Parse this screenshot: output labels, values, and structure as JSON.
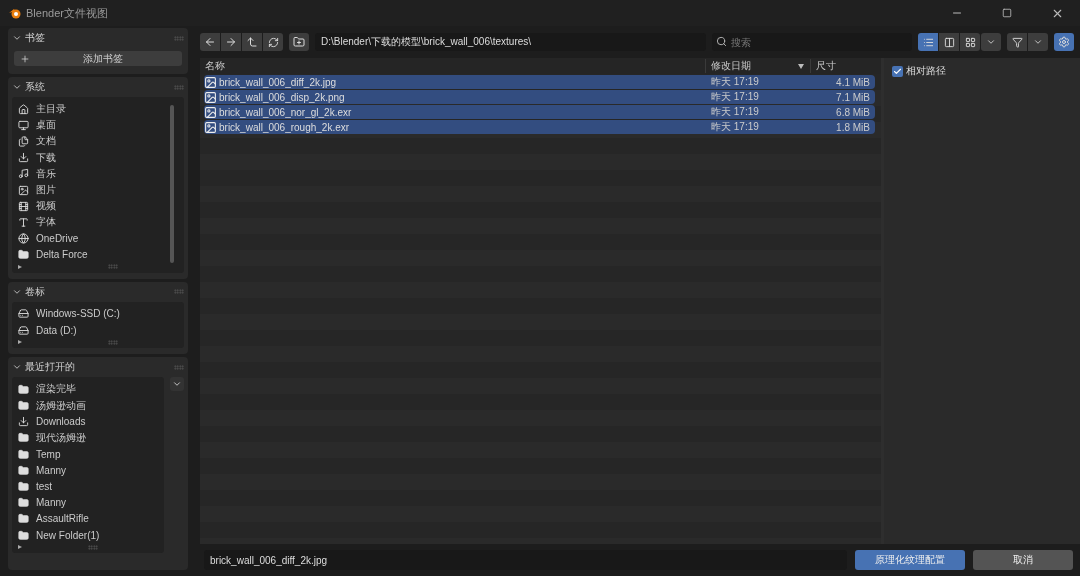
{
  "window": {
    "title": "Blender文件视图"
  },
  "sidebar": {
    "sections": [
      {
        "title": "书签",
        "expanded": true,
        "add_button": "添加书签"
      },
      {
        "title": "系统",
        "expanded": true,
        "items": [
          {
            "label": "主目录",
            "kind": "home"
          },
          {
            "label": "桌面",
            "kind": "desktop"
          },
          {
            "label": "文档",
            "kind": "documents"
          },
          {
            "label": "下载",
            "kind": "download"
          },
          {
            "label": "音乐",
            "kind": "music"
          },
          {
            "label": "图片",
            "kind": "image"
          },
          {
            "label": "视频",
            "kind": "video"
          },
          {
            "label": "字体",
            "kind": "font"
          },
          {
            "label": "OneDrive",
            "kind": "globe"
          },
          {
            "label": "Delta Force",
            "kind": "folder"
          }
        ]
      },
      {
        "title": "卷标",
        "expanded": true,
        "items": [
          {
            "label": "Windows-SSD (C:)",
            "kind": "drive"
          },
          {
            "label": "Data (D:)",
            "kind": "drive"
          }
        ]
      },
      {
        "title": "最近打开的",
        "expanded": true,
        "items": [
          {
            "label": "渲染完毕",
            "kind": "folder"
          },
          {
            "label": "汤姆逊动画",
            "kind": "folder"
          },
          {
            "label": "Downloads",
            "kind": "download"
          },
          {
            "label": "现代汤姆逊",
            "kind": "folder"
          },
          {
            "label": "Temp",
            "kind": "folder"
          },
          {
            "label": "Manny",
            "kind": "folder"
          },
          {
            "label": "test",
            "kind": "folder"
          },
          {
            "label": "Manny",
            "kind": "folder"
          },
          {
            "label": "AssaultRifle",
            "kind": "folder"
          },
          {
            "label": "New Folder(1)",
            "kind": "folder"
          }
        ]
      }
    ]
  },
  "toolbar": {
    "path": "D:\\Blender\\下载的模型\\brick_wall_006\\textures\\",
    "search": {
      "placeholder": "搜索"
    },
    "display_modes": [
      {
        "kind": "list",
        "selected": true
      },
      {
        "kind": "columns",
        "selected": false
      },
      {
        "kind": "thumbnails",
        "selected": false
      }
    ],
    "settings_open": true
  },
  "table": {
    "columns": [
      {
        "label": "名称",
        "sorted": false
      },
      {
        "label": "修改日期",
        "sorted": true
      },
      {
        "label": "尺寸",
        "sorted": false
      }
    ],
    "rows": [
      {
        "name": "brick_wall_006_diff_2k.jpg",
        "date": "昨天 17:19",
        "size": "4.1 MiB",
        "selected": true
      },
      {
        "name": "brick_wall_006_disp_2k.png",
        "date": "昨天 17:19",
        "size": "7.1 MiB",
        "selected": true
      },
      {
        "name": "brick_wall_006_nor_gl_2k.exr",
        "date": "昨天 17:19",
        "size": "6.8 MiB",
        "selected": true
      },
      {
        "name": "brick_wall_006_rough_2k.exr",
        "date": "昨天 17:19",
        "size": "1.8 MiB",
        "selected": true
      }
    ]
  },
  "side_panel": {
    "relative_path": {
      "label": "相对路径",
      "checked": true
    }
  },
  "bottom_bar": {
    "filename": "brick_wall_006_diff_2k.jpg",
    "confirm": "原理化纹理配置",
    "cancel": "取消"
  }
}
